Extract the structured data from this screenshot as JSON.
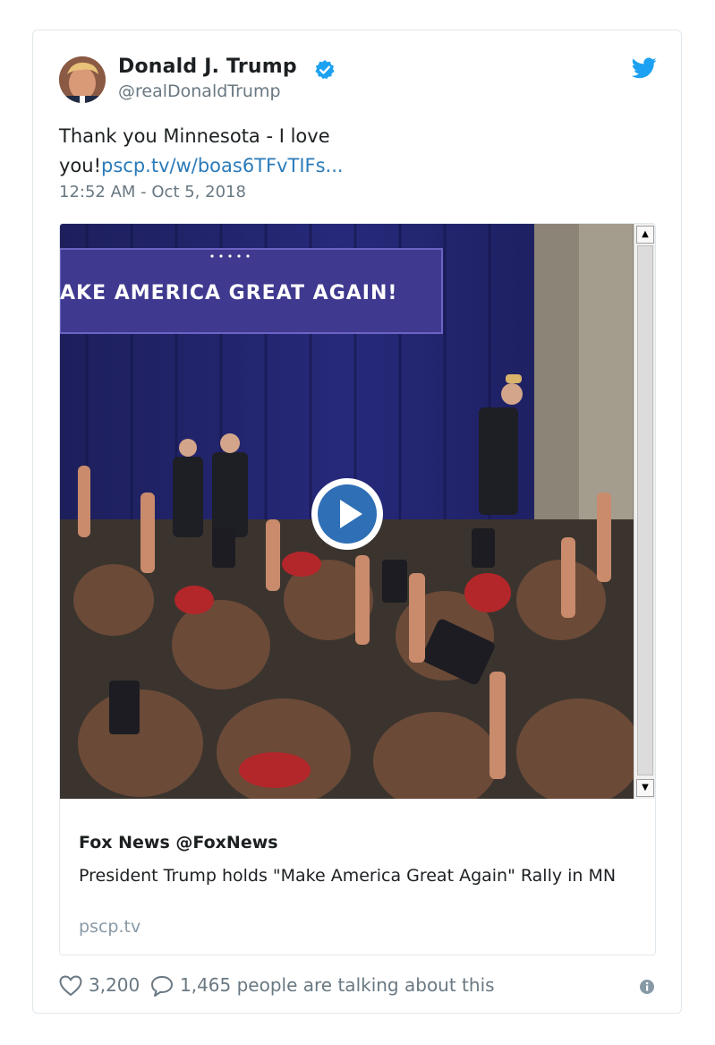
{
  "tweet": {
    "author_name": "Donald J. Trump",
    "author_handle": "@realDonaldTrump",
    "text_prefix": "Thank you Minnesota - I love you!",
    "link_text": "pscp.tv/w/boas6TFvTIFs...",
    "timestamp": "12:52 AM - Oct 5, 2018"
  },
  "embed": {
    "banner_text": "AKE AMERICA GREAT AGAIN!",
    "title": "Fox News @FoxNews",
    "description": "President Trump holds \"Make America Great Again\" Rally in MN",
    "domain": "pscp.tv",
    "scroll_up": "▲",
    "scroll_down": "▼"
  },
  "actions": {
    "likes": "3,200",
    "talking": "1,465 people are talking about this"
  },
  "icons": {
    "verified": "verified-badge-icon",
    "brand": "twitter-bird-icon",
    "play": "play-icon",
    "like": "heart-icon",
    "reply": "speech-bubble-icon",
    "info": "info-icon"
  },
  "colors": {
    "brand": "#1da1f2",
    "link": "#2b7bb9",
    "muted": "#697882",
    "banner": "#3f3a8f"
  }
}
